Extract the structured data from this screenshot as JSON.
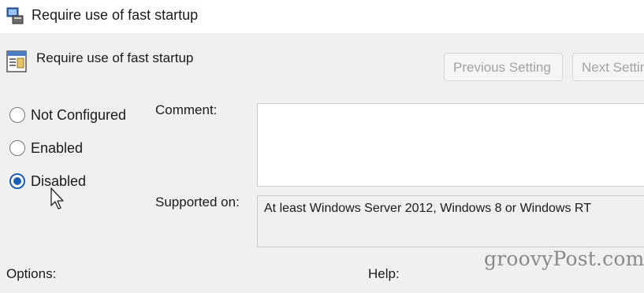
{
  "window": {
    "title": "Require use of fast startup"
  },
  "policy": {
    "title": "Require use of fast startup"
  },
  "buttons": {
    "previous": "Previous Setting",
    "next": "Next Setting"
  },
  "options": [
    {
      "label": "Not Configured",
      "selected": false
    },
    {
      "label": "Enabled",
      "selected": false
    },
    {
      "label": "Disabled",
      "selected": true
    }
  ],
  "comment": {
    "label": "Comment:",
    "value": ""
  },
  "supported": {
    "label": "Supported on:",
    "value": "At least Windows Server 2012, Windows 8 or Windows RT"
  },
  "sections": {
    "options_label": "Options:",
    "help_label": "Help:"
  },
  "watermark": "groovyPost.com",
  "colors": {
    "accent": "#1b5fb4",
    "background": "#f0f0f0",
    "titlebar": "#ffffff"
  }
}
